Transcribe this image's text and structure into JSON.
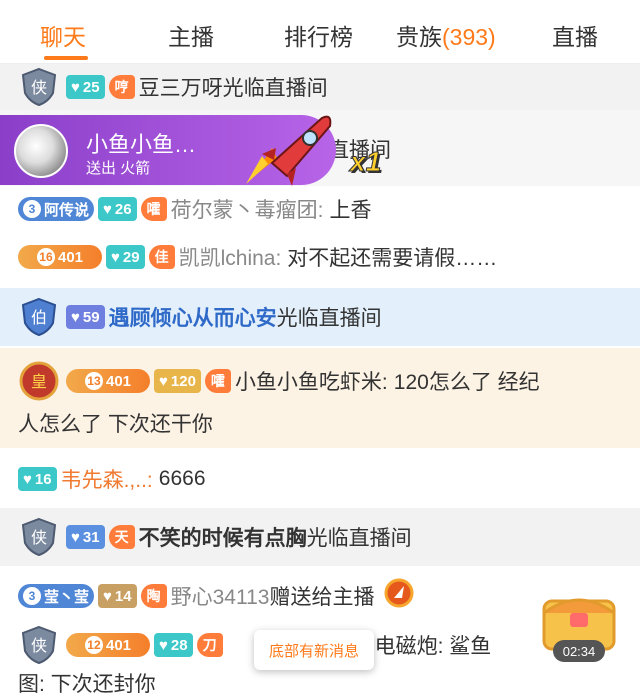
{
  "tabs": [
    {
      "label": "聊天",
      "count": ""
    },
    {
      "label": "主播",
      "count": ""
    },
    {
      "label": "排行榜",
      "count": ""
    },
    {
      "label": "贵族",
      "count": "(393)"
    },
    {
      "label": "直播",
      "count": ""
    }
  ],
  "colors": {
    "accent": "#ff7a1a",
    "noble_blue": "#2f6ac9",
    "gift_purple": "#8b3fc9"
  },
  "messages": {
    "m1": {
      "noble": "侠",
      "fan_level": "25",
      "fan_badge": "哼",
      "text": "豆三万呀光临直播间"
    },
    "gift": {
      "name": "小鱼小鱼…",
      "action": "送出 火箭",
      "multiplier": "x1",
      "under_text": "直播间"
    },
    "m2": {
      "ring_num": "3",
      "ring_label": "阿传说",
      "fan_level": "26",
      "fan_badge": "嚯",
      "user": "荷尔蒙丶毒瘤团:",
      "text": "上香"
    },
    "m3": {
      "lvl_num": "16",
      "lvl_val": "401",
      "fan_level": "29",
      "fan_badge": "佳",
      "user": "凯凯lchina:",
      "text": "对不起还需要请假……"
    },
    "m4": {
      "noble": "伯",
      "fan_level": "59",
      "user": "遇顾倾心从而心安",
      "text": "光临直播间"
    },
    "m5": {
      "noble": "皇",
      "lvl_num": "13",
      "lvl_val": "401",
      "fan_level": "120",
      "fan_badge": "嚯",
      "user": "小鱼小鱼吃虾米:",
      "text1": "120怎么了 经纪",
      "text2": "人怎么了 下次还干你"
    },
    "m6": {
      "fan_level": "16",
      "user": "韦先森.,..:",
      "text": "6666"
    },
    "m7": {
      "noble": "侠",
      "fan_level": "31",
      "fan_badge": "天",
      "user": "不笑的时候有点胸",
      "text": "光临直播间"
    },
    "m8": {
      "ring_num": "3",
      "ring_label": "莹丶莹",
      "fan_level": "14",
      "fan_badge": "陶",
      "user": "野心34113",
      "text": "赠送给主播"
    },
    "m9": {
      "noble": "侠",
      "lvl_num": "12",
      "lvl_val": "401",
      "fan_level": "28",
      "fan_badge": "刀",
      "tail_text": "炫超电磁炮: 鲨鱼",
      "text2": "图: 下次还封你"
    }
  },
  "toast": "底部有新消息",
  "timer": "02:34"
}
